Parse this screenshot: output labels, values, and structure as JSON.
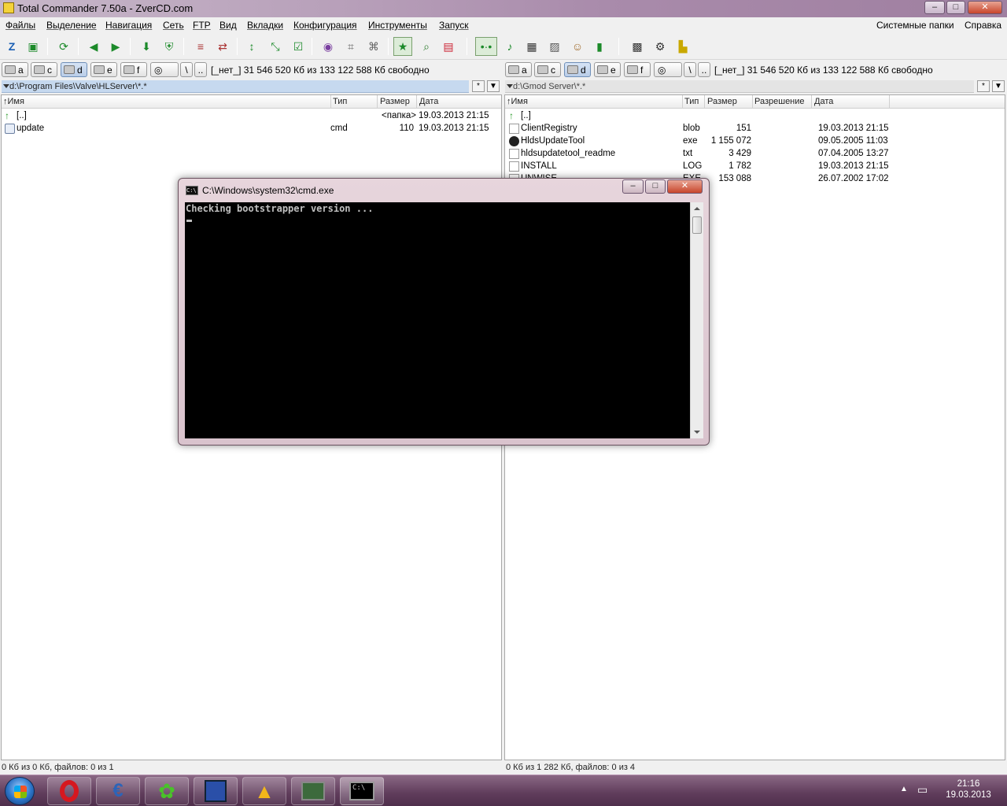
{
  "window": {
    "title": "Total Commander 7.50a - ZverCD.com",
    "buttons": {
      "minimize": "–",
      "maximize": "□",
      "close": "✕"
    }
  },
  "menu": {
    "items": [
      "Файлы",
      "Выделение",
      "Навигация",
      "Сеть",
      "FTP",
      "Вид",
      "Вкладки",
      "Конфигурация",
      "Инструменты",
      "Запуск"
    ],
    "right": [
      "Системные папки",
      "Справка"
    ]
  },
  "toolbar": {
    "icons": [
      "z-icon",
      "pack-icon",
      "refresh-icon",
      "back-icon",
      "forward-icon",
      "unpack-icon",
      "shield-icon",
      "compare-icon",
      "sync-icon",
      "sort-icon",
      "select-icon",
      "check-icon",
      "globe-icon",
      "ftp-icon",
      "ftp-new-icon",
      "star-icon",
      "search-icon",
      "multirename-icon",
      "view-icon",
      "music-icon",
      "film-icon",
      "image-icon",
      "user-icon",
      "archive-icon",
      "calc-icon",
      "settings-icon",
      "chart-icon"
    ]
  },
  "drives_left": {
    "drives": [
      "a",
      "c",
      "d",
      "e",
      "f"
    ],
    "active": "d",
    "extra": [
      "\\",
      ".."
    ],
    "info": "[_нет_]  31 546 520 Кб из 133 122 588 Кб свободно"
  },
  "drives_right": {
    "drives": [
      "a",
      "c",
      "d",
      "e",
      "f"
    ],
    "active": "d",
    "extra": [
      "\\",
      ".."
    ],
    "info": "[_нет_]  31 546 520 Кб из 133 122 588 Кб свободно"
  },
  "left_panel": {
    "path": "d:\\Program Files\\Valve\\HLServer\\*.*",
    "path_buttons": [
      "*",
      "▼"
    ],
    "columns": [
      "Имя",
      "Тип",
      "Размер",
      "Дата"
    ],
    "rows": [
      {
        "name": "[..]",
        "type": "",
        "size": "<папка>",
        "date": "19.03.2013 21:15",
        "icon": "up-icon"
      },
      {
        "name": "update",
        "type": "cmd",
        "size": "110",
        "date": "19.03.2013 21:15",
        "icon": "cmd-file-icon"
      }
    ],
    "status": "0 Кб из 0 Кб, файлов: 0 из 1"
  },
  "right_panel": {
    "path": "d:\\Gmod Server\\*.*",
    "path_buttons": [
      "*",
      "▼"
    ],
    "columns": [
      "Имя",
      "Тип",
      "Размер",
      "Разрешение",
      "Дата"
    ],
    "rows": [
      {
        "name": "[..]",
        "type": "",
        "size": "",
        "perm": "",
        "date": "",
        "icon": "up-icon"
      },
      {
        "name": "ClientRegistry",
        "type": "blob",
        "size": "151",
        "perm": "",
        "date": "19.03.2013 21:15",
        "icon": "file-icon"
      },
      {
        "name": "HldsUpdateTool",
        "type": "exe",
        "size": "1 155 072",
        "perm": "",
        "date": "09.05.2005 11:03",
        "icon": "steam-icon"
      },
      {
        "name": "hldsupdatetool_readme",
        "type": "txt",
        "size": "3 429",
        "perm": "",
        "date": "07.04.2005 13:27",
        "icon": "file-icon"
      },
      {
        "name": "INSTALL",
        "type": "LOG",
        "size": "1 782",
        "perm": "",
        "date": "19.03.2013 21:15",
        "icon": "file-icon"
      },
      {
        "name": "UNWISE",
        "type": "EXE",
        "size": "153 088",
        "perm": "",
        "date": "26.07.2002 17:02",
        "icon": "setup-icon"
      }
    ],
    "status": "0 Кб из 1 282 Кб, файлов: 0 из 4"
  },
  "cmd": {
    "title": "C:\\Windows\\system32\\cmd.exe",
    "icon_text": "C:\\",
    "output": "Checking bootstrapper version ..."
  },
  "taskbar": {
    "time": "21:16",
    "date": "19.03.2013",
    "apps": [
      "opera-icon",
      "ccleaner-icon",
      "icq-icon",
      "floppy-icon",
      "aimp-icon",
      "monitor-icon",
      "cmd-icon"
    ]
  }
}
